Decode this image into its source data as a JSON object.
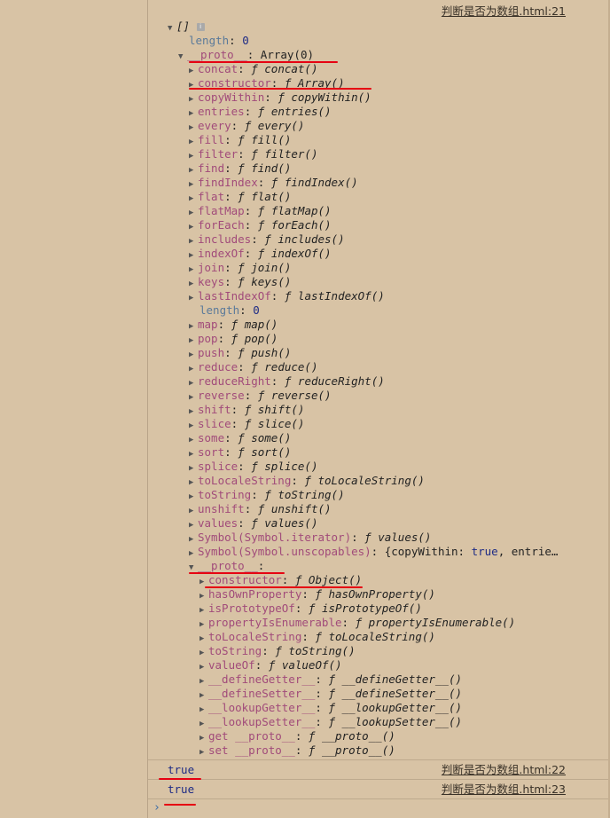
{
  "log1": {
    "source": "判断是否为数组.html:21",
    "array_summary": "[]",
    "length_key": "length",
    "length_val": "0",
    "proto_key": "__proto__",
    "proto_val": "Array(0)",
    "array_proto_items": [
      {
        "key": "concat",
        "name": "concat()"
      },
      {
        "key": "constructor",
        "name": "Array()"
      },
      {
        "key": "copyWithin",
        "name": "copyWithin()"
      },
      {
        "key": "entries",
        "name": "entries()"
      },
      {
        "key": "every",
        "name": "every()"
      },
      {
        "key": "fill",
        "name": "fill()"
      },
      {
        "key": "filter",
        "name": "filter()"
      },
      {
        "key": "find",
        "name": "find()"
      },
      {
        "key": "findIndex",
        "name": "findIndex()"
      },
      {
        "key": "flat",
        "name": "flat()"
      },
      {
        "key": "flatMap",
        "name": "flatMap()"
      },
      {
        "key": "forEach",
        "name": "forEach()"
      },
      {
        "key": "includes",
        "name": "includes()"
      },
      {
        "key": "indexOf",
        "name": "indexOf()"
      },
      {
        "key": "join",
        "name": "join()"
      },
      {
        "key": "keys",
        "name": "keys()"
      },
      {
        "key": "lastIndexOf",
        "name": "lastIndexOf()"
      }
    ],
    "inner_length_key": "length",
    "inner_length_val": "0",
    "array_proto_items2": [
      {
        "key": "map",
        "name": "map()"
      },
      {
        "key": "pop",
        "name": "pop()"
      },
      {
        "key": "push",
        "name": "push()"
      },
      {
        "key": "reduce",
        "name": "reduce()"
      },
      {
        "key": "reduceRight",
        "name": "reduceRight()"
      },
      {
        "key": "reverse",
        "name": "reverse()"
      },
      {
        "key": "shift",
        "name": "shift()"
      },
      {
        "key": "slice",
        "name": "slice()"
      },
      {
        "key": "some",
        "name": "some()"
      },
      {
        "key": "sort",
        "name": "sort()"
      },
      {
        "key": "splice",
        "name": "splice()"
      },
      {
        "key": "toLocaleString",
        "name": "toLocaleString()"
      },
      {
        "key": "toString",
        "name": "toString()"
      },
      {
        "key": "unshift",
        "name": "unshift()"
      },
      {
        "key": "values",
        "name": "values()"
      },
      {
        "key": "Symbol(Symbol.iterator)",
        "name": "values()"
      }
    ],
    "unscopables_key": "Symbol(Symbol.unscopables)",
    "unscopables_val_open": "{copyWithin: ",
    "unscopables_val_bool": "true",
    "unscopables_val_rest": ", entrie…",
    "inner_proto_key": "__proto__",
    "inner_proto_val": "",
    "object_proto_items": [
      {
        "key": "constructor",
        "name": "Object()"
      },
      {
        "key": "hasOwnProperty",
        "name": "hasOwnProperty()"
      },
      {
        "key": "isPrototypeOf",
        "name": "isPrototypeOf()"
      },
      {
        "key": "propertyIsEnumerable",
        "name": "propertyIsEnumerable()"
      },
      {
        "key": "toLocaleString",
        "name": "toLocaleString()"
      },
      {
        "key": "toString",
        "name": "toString()"
      },
      {
        "key": "valueOf",
        "name": "valueOf()"
      },
      {
        "key": "__defineGetter__",
        "name": "__defineGetter__()"
      },
      {
        "key": "__defineSetter__",
        "name": "__defineSetter__()"
      },
      {
        "key": "__lookupGetter__",
        "name": "__lookupGetter__()"
      },
      {
        "key": "__lookupSetter__",
        "name": "__lookupSetter__()"
      },
      {
        "key": "get __proto__",
        "name": "__proto__()"
      },
      {
        "key": "set __proto__",
        "name": "__proto__()"
      }
    ],
    "func_symbol": "ƒ"
  },
  "log2": {
    "value": "true",
    "source": "判断是否为数组.html:22"
  },
  "log3": {
    "value": "true",
    "source": "判断是否为数组.html:23"
  },
  "prompt_symbol": "›",
  "annotation_color": "#e60012"
}
